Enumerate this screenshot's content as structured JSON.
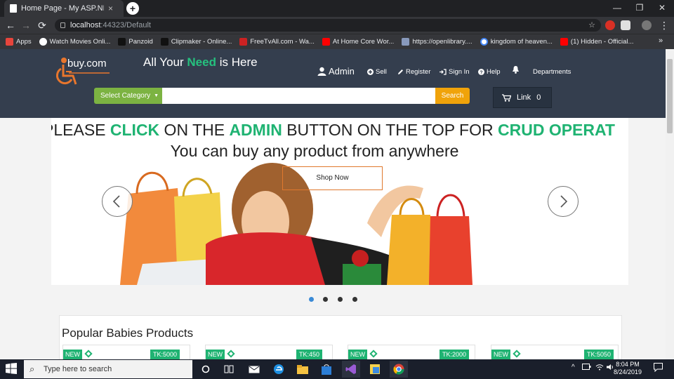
{
  "browser": {
    "tab_title": "Home Page - My ASP.NET Applic",
    "tab_close": "×",
    "new_tab": "+",
    "window_controls": [
      "—",
      "❐",
      "✕"
    ],
    "url_host": "localhost",
    "url_rest": ":44323/Default",
    "bookmarks": [
      {
        "label": "Apps",
        "color": "#e8453c"
      },
      {
        "label": "Watch Movies Onli...",
        "color": "#ffffff"
      },
      {
        "label": "Panzoid",
        "color": "#222222"
      },
      {
        "label": "Clipmaker - Online...",
        "color": "#222222"
      },
      {
        "label": "FreeTvAll.com - Wa...",
        "color": "#cc2222"
      },
      {
        "label": "At Home Core Wor...",
        "color": "#ff0000"
      },
      {
        "label": "https://openlibrary....",
        "color": "#8899bb"
      },
      {
        "label": "kingdom of heaven...",
        "color": "#4285f4"
      },
      {
        "label": "(1) Hidden - Official...",
        "color": "#ff0000"
      }
    ],
    "more": "»"
  },
  "header": {
    "logo_text": "buy.com",
    "tagline_pre": "All Your",
    "tagline_need": "Need",
    "tagline_post": "is Here",
    "nav": {
      "admin": "Admin",
      "sell": "Sell",
      "register": "Register",
      "signin": "Sign In",
      "help": "Help",
      "departments": "Departments"
    },
    "category_label": "Select Category",
    "search_placeholder": "",
    "search_label": "Search",
    "cart_label": "Link",
    "cart_count": "0"
  },
  "carousel": {
    "marquee_1": "PLEASE ",
    "marquee_click": "CLICK",
    "marquee_2": " ON THE ",
    "marquee_admin": "ADMIN",
    "marquee_3": " BUTTON ON THE TOP FOR ",
    "marquee_crud": "CRUD OPERAT",
    "promo": "You can buy any product from anywhere",
    "shop_now": "Shop Now",
    "active_slide": 1,
    "slide_count": 4
  },
  "popular": {
    "title": "Popular Babies Products",
    "products": [
      {
        "badge": "NEW",
        "price": "TK:5000"
      },
      {
        "badge": "NEW",
        "price": "TK:450"
      },
      {
        "badge": "NEW",
        "price": "TK:2000"
      },
      {
        "badge": "NEW",
        "price": "TK:5050"
      }
    ]
  },
  "taskbar": {
    "search_placeholder": "Type here to search",
    "time": "8:04 PM",
    "date": "8/24/2019"
  },
  "colors": {
    "accent_green": "#1fb372",
    "header_bg": "#343e4e",
    "search_orange": "#f0a30a",
    "category_green": "#7cb342"
  }
}
